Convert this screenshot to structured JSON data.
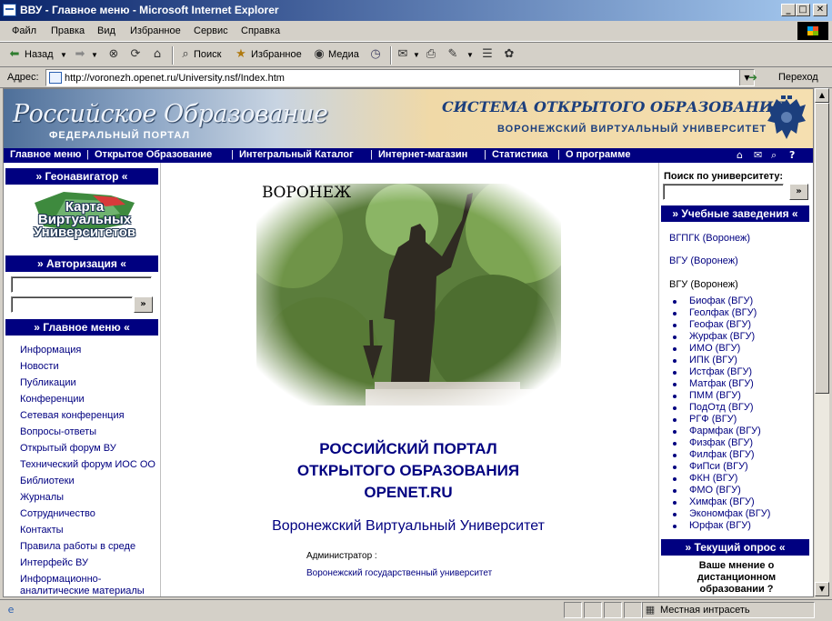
{
  "window": {
    "title": "ВВУ - Главное меню - Microsoft Internet Explorer"
  },
  "menu": [
    "Файл",
    "Правка",
    "Вид",
    "Избранное",
    "Сервис",
    "Справка"
  ],
  "toolbar": {
    "back": "Назад",
    "search": "Поиск",
    "favorites": "Избранное",
    "media": "Медиа"
  },
  "address": {
    "label": "Адрес:",
    "url": "http://voronezh.openet.ru/University.nsf/Index.htm",
    "go": "Переход"
  },
  "header": {
    "logo": "Российское Образование",
    "logo_sub": "ФЕДЕРАЛЬНЫЙ ПОРТАЛ",
    "system": "СИСТЕМА ОТКРЫТОГО ОБРАЗОВАНИЯ",
    "university": "ВОРОНЕЖСКИЙ ВИРТУАЛЬНЫЙ УНИВЕРСИТЕТ"
  },
  "nav": [
    "Главное меню",
    "Открытое Образование",
    "Интегральный Каталог",
    "Интернет-магазин",
    "Статистика",
    "О программе"
  ],
  "left": {
    "geo_title": "» Геонавигатор «",
    "map_text": "Карта Виртуальных Университетов",
    "auth_title": "» Авторизация «",
    "go": "»",
    "menu_title": "» Главное меню «",
    "items": [
      "Информация",
      "Новости",
      "Публикации",
      "Конференции",
      "Сетевая конференция",
      "Вопросы-ответы",
      "Открытый форум ВУ",
      "Технический форум ИОС ОО",
      "Библиотеки",
      "Журналы",
      "Сотрудничество",
      "Контакты",
      "Правила работы в среде",
      "Интерфейс ВУ",
      "Информационно-аналитические материалы"
    ]
  },
  "center": {
    "city": "ВОРОНЕЖ",
    "portal_line1": "РОССИЙСКИЙ ПОРТАЛ",
    "portal_line2": "ОТКРЫТОГО ОБРАЗОВАНИЯ",
    "portal_line3": "OPENET.RU",
    "university": "Воронежский Виртуальный Университет",
    "admin_label": "Администратор :",
    "admin_value": "Воронежский государственный университет"
  },
  "right": {
    "search_label": "Поиск по университету:",
    "go": "»",
    "inst_title": "» Учебные заведения «",
    "inst1": "ВГПГК (Воронеж)",
    "inst2": "ВГУ (Воронеж)",
    "inst3": "ВГУ (Воронеж)",
    "faculties": [
      "Биофак (ВГУ)",
      "Геолфак (ВГУ)",
      "Геофак (ВГУ)",
      "Журфак (ВГУ)",
      "ИМО (ВГУ)",
      "ИПК (ВГУ)",
      "Истфак (ВГУ)",
      "Матфак (ВГУ)",
      "ПММ (ВГУ)",
      "ПодОтд (ВГУ)",
      "РГФ (ВГУ)",
      "Фармфак (ВГУ)",
      "Физфак (ВГУ)",
      "Филфак (ВГУ)",
      "ФиПси (ВГУ)",
      "ФКН (ВГУ)",
      "ФМО (ВГУ)",
      "Химфак (ВГУ)",
      "Экономфак (ВГУ)",
      "Юрфак (ВГУ)"
    ],
    "poll_title": "» Текущий опрос «",
    "poll_q1": "Ваше мнение о",
    "poll_q2": "дистанционном",
    "poll_q3": "образовании ?"
  },
  "status": {
    "zone": "Местная интрасеть"
  }
}
